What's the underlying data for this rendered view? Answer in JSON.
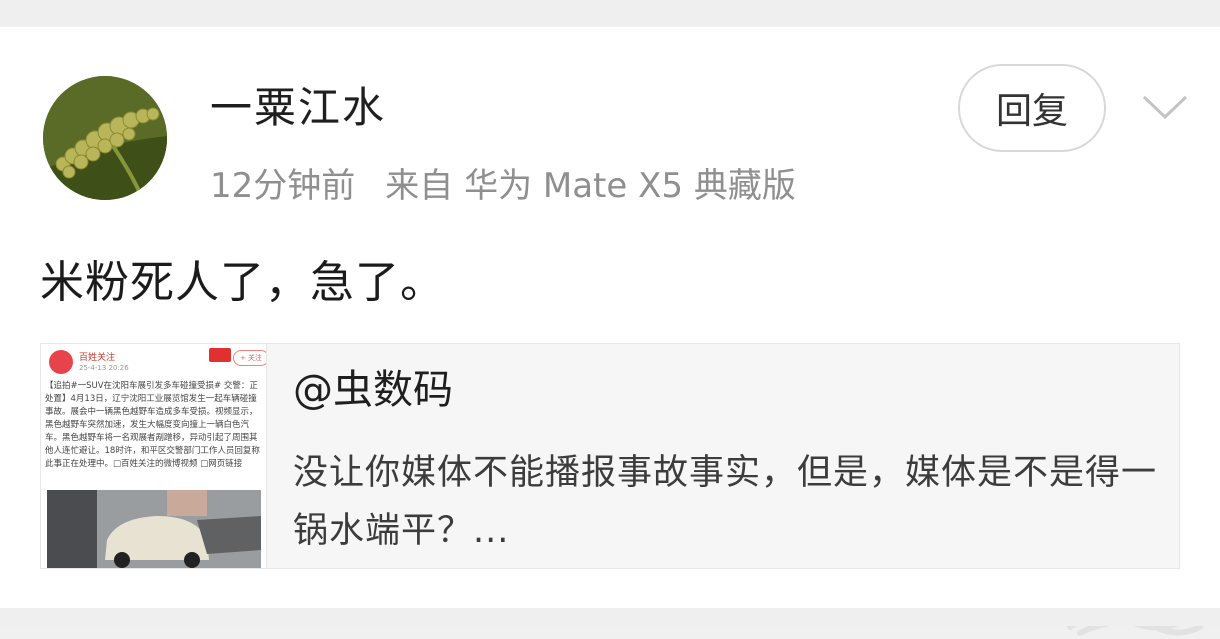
{
  "post": {
    "username": "一粟江水",
    "time": "12分钟前",
    "source": "来自 华为 Mate X5 典藏版",
    "reply_label": "回复",
    "text": "米粉死人了，急了。"
  },
  "quote": {
    "author": "@虫数码",
    "body": "没让你媒体不能播报事故事实，但是，媒体是不是得一锅水端平？..."
  },
  "thumbnail": {
    "account": "百姓关注",
    "date": "25-4-13 20:26",
    "follow": "+ 关注",
    "text": "【追拍#一SUV在沈阳车展引发多车碰撞受损# 交警：正处置】4月13日，辽宁沈阳工业展览馆发生一起车辆碰撞事故。展会中一辆黑色越野车造成多车受损。视频显示，黑色越野车突然加速，发生大幅度变向撞上一辆白色汽车。黑色越野车将一名观展者剐蹭移，异动引起了周围其他人连忙避让。18时许，和平区交警部门工作人员回复称此事正在处理中。□百姓关注的微博视频 □网页链接"
  },
  "colors": {
    "background": "#f0f0f0",
    "card": "#ffffff",
    "meta_text": "#8f8f8f",
    "quote_bg": "#f6f6f6"
  },
  "icons": [
    "avatar-image",
    "chevron-down-icon",
    "watermark-icon"
  ]
}
